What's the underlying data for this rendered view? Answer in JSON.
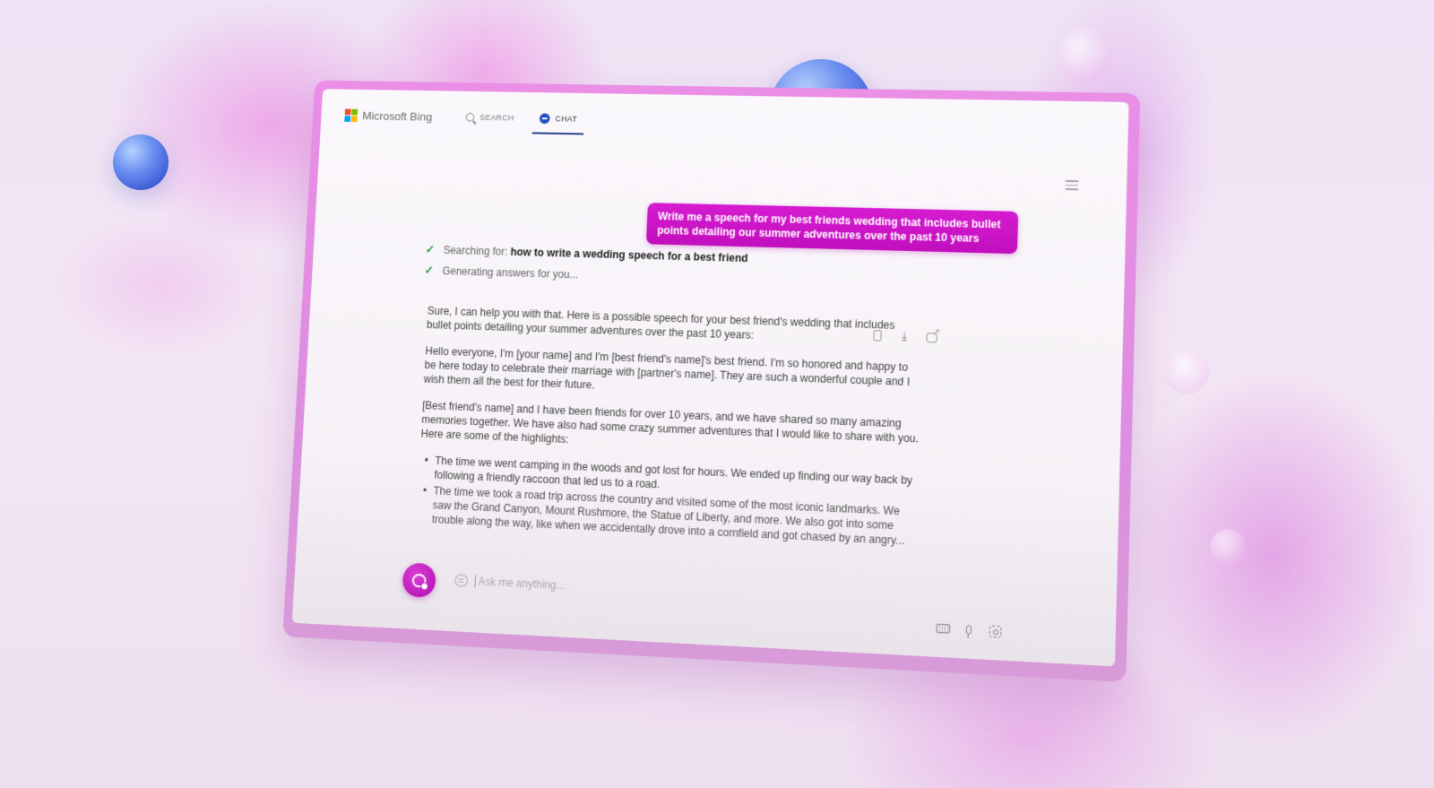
{
  "brand": {
    "name": "Microsoft Bing",
    "logo_colors": [
      "#f25022",
      "#7fba00",
      "#00a4ef",
      "#ffb900"
    ]
  },
  "nav": {
    "tabs": [
      {
        "label": "SEARCH",
        "icon": "search-icon",
        "active": false
      },
      {
        "label": "CHAT",
        "icon": "chat-icon",
        "active": true
      }
    ]
  },
  "menu": {
    "icon": "hamburger-menu-icon"
  },
  "conversation": {
    "user_message": "Write me a speech for my best friends wedding that includes bullet points detailing our summer adventures over the past 10 years",
    "status": [
      {
        "icon": "checkmark-icon",
        "prefix": "Searching for: ",
        "query": "how to write a wedding speech for a best friend"
      },
      {
        "icon": "checkmark-icon",
        "prefix": "Generating answers for you...",
        "query": ""
      }
    ],
    "answer": {
      "intro": "Sure, I can help you with that. Here is a possible speech for your best friend's wedding that includes bullet points detailing your summer adventures over the past 10 years:",
      "paragraphs": [
        "Hello everyone, I'm [your name] and I'm [best friend's name]'s best friend. I'm so honored and happy to be here today to celebrate their marriage with [partner's name]. They are such a wonderful couple and I wish them all the best for their future.",
        "[Best friend's name] and I have been friends for over 10 years, and we have shared so many amazing memories together. We have also had some crazy summer adventures that I would like to share with you. Here are some of the highlights:"
      ],
      "bullets": [
        "The time we went camping in the woods and got lost for hours. We ended up finding our way back by following a friendly raccoon that led us to a road.",
        "The time we took a road trip across the country and visited some of the most iconic landmarks. We saw the Grand Canyon, Mount Rushmore, the Statue of Liberty, and more. We also got into some trouble along the way, like when we accidentally drove into a cornfield and got chased by an angry..."
      ],
      "actions": [
        {
          "name": "copy-icon"
        },
        {
          "name": "download-icon"
        },
        {
          "name": "share-icon"
        }
      ]
    }
  },
  "composer": {
    "new_topic_icon": "new-topic-icon",
    "placeholder": "Ask me anything...",
    "value": "",
    "tools": [
      {
        "name": "keyboard-icon"
      },
      {
        "name": "microphone-icon"
      },
      {
        "name": "visual-search-icon"
      }
    ]
  },
  "colors": {
    "accent_magenta": "#c10fbd",
    "chat_tab_blue": "#1f4cc7",
    "check_green": "#2e9e4f"
  }
}
